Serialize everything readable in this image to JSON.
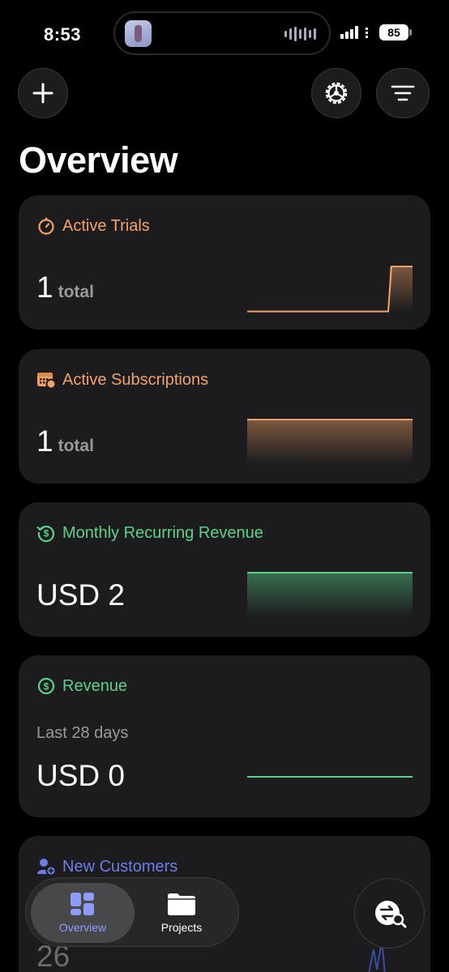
{
  "status_bar": {
    "time": "8:53",
    "battery": "85"
  },
  "header": {
    "title": "Overview"
  },
  "cards": {
    "active_trials": {
      "title": "Active Trials",
      "value": "1",
      "unit": "total",
      "trend": [
        0,
        0,
        0,
        0,
        0,
        0,
        0,
        0,
        0,
        0,
        0,
        1
      ]
    },
    "active_subscriptions": {
      "title": "Active Subscriptions",
      "value": "1",
      "unit": "total",
      "trend": [
        1,
        1,
        1,
        1,
        1,
        1,
        1,
        1,
        1,
        1,
        1,
        1
      ]
    },
    "mrr": {
      "title": "Monthly Recurring Revenue",
      "value": "USD 2",
      "trend": [
        1,
        1,
        1,
        1,
        1,
        1,
        1,
        1,
        1,
        1,
        1,
        1
      ]
    },
    "revenue": {
      "title": "Revenue",
      "period": "Last 28 days",
      "value": "USD 0",
      "trend": [
        0,
        0,
        0,
        0,
        0,
        0,
        0,
        0,
        0,
        0,
        0,
        0
      ]
    },
    "new_customers": {
      "title": "New Customers",
      "value": "26"
    }
  },
  "tab_bar": {
    "overview_label": "Overview",
    "projects_label": "Projects"
  },
  "colors": {
    "orange": "#f4a268",
    "green": "#5ad28a",
    "blue": "#6c7de8",
    "card": "#1c1c1e"
  }
}
